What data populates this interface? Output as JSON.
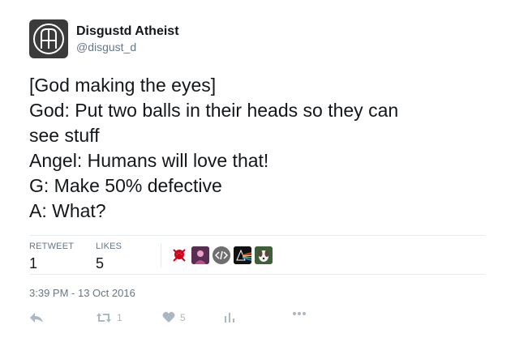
{
  "user": {
    "display_name": "Disgustd Atheist",
    "handle": "@disgust_d"
  },
  "tweet": {
    "lines": [
      "[God making the eyes]",
      "God: Put two balls in their heads so they can",
      "see stuff",
      "Angel: Humans will love that!",
      "G: Make 50% defective",
      "A: What?"
    ]
  },
  "stats": {
    "retweet_label": "RETWEET",
    "retweet_count": "1",
    "likes_label": "LIKES",
    "likes_count": "5",
    "likers": [
      "skull-red-avatar",
      "purple-portrait-avatar",
      "code-tag-avatar",
      "rainbow-prism-avatar",
      "dog-photo-avatar"
    ]
  },
  "timestamp": "3:39 PM - 13 Oct 2016",
  "actions": {
    "retweet_count": "1",
    "like_count": "5"
  },
  "colors": {
    "text": "#14171a",
    "secondary": "#657786",
    "icon": "#aab8c2",
    "divider": "#e6ecf0"
  }
}
